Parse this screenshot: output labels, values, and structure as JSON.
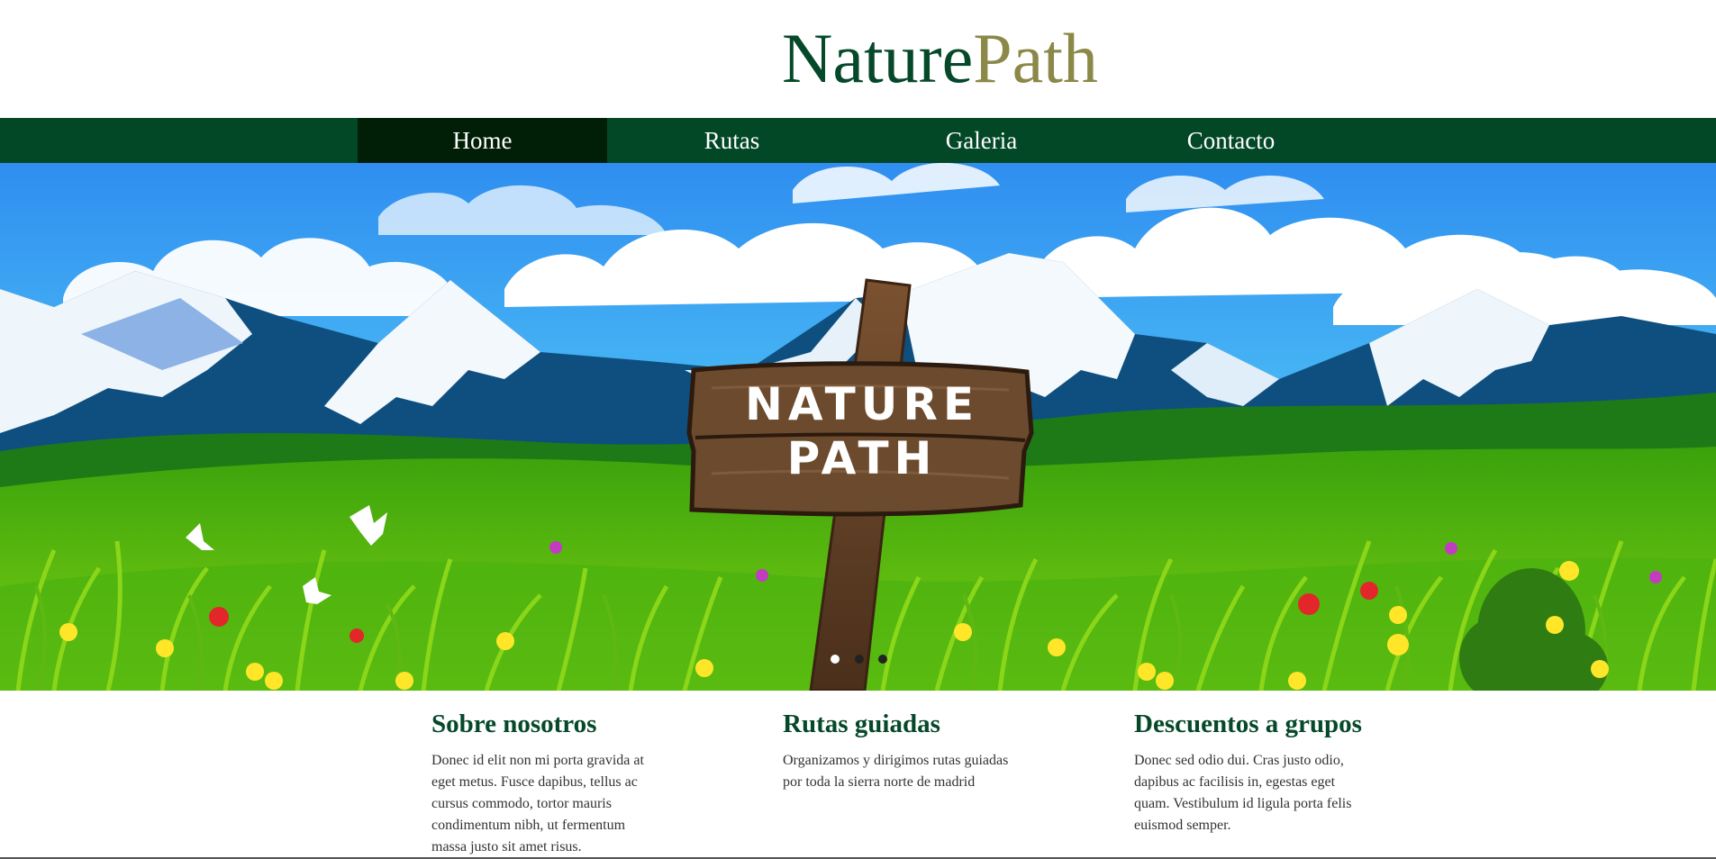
{
  "brand": {
    "part1": "Nature",
    "part2": "Path",
    "color1": "#06492a",
    "color2": "#8b8848"
  },
  "nav": {
    "items": [
      {
        "label": "Home",
        "active": true
      },
      {
        "label": "Rutas",
        "active": false
      },
      {
        "label": "Galeria",
        "active": false
      },
      {
        "label": "Contacto",
        "active": false
      }
    ],
    "bg": "#024726",
    "active_bg": "#011f06"
  },
  "hero": {
    "sign_line1": "NATURE",
    "sign_line2": "PATH",
    "slides": 3,
    "active_slide": 1
  },
  "features": [
    {
      "title": "Sobre nosotros",
      "text": "Donec id elit non mi porta gravida at eget metus. Fusce dapibus, tellus ac cursus commodo, tortor mauris condimentum nibh, ut fermentum massa justo sit amet risus."
    },
    {
      "title": "Rutas guiadas",
      "text": "Organizamos y dirigimos rutas guiadas por toda la sierra norte de madrid"
    },
    {
      "title": "Descuentos a grupos",
      "text": "Donec sed odio dui. Cras justo odio, dapibus ac facilisis in, egestas eget quam. Vestibulum id ligula porta felis euismod semper."
    }
  ]
}
